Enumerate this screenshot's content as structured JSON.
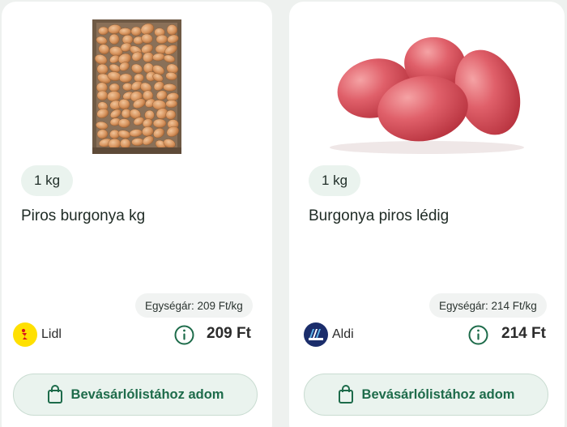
{
  "products": [
    {
      "image": "crate-of-red-potatoes",
      "quantity": "1 kg",
      "name": "Piros burgonya kg",
      "unit_price": "Egységár: 209 Ft/kg",
      "store": "Lidl",
      "store_icon": "lidl-logo-icon",
      "price": "209 Ft",
      "add_button": "Bevásárlólistához adom"
    },
    {
      "image": "red-potatoes",
      "quantity": "1 kg",
      "name": "Burgonya piros lédig",
      "unit_price": "Egységár: 214 Ft/kg",
      "store": "Aldi",
      "store_icon": "aldi-logo-icon",
      "price": "214 Ft",
      "add_button": "Bevásárlólistához adom"
    }
  ],
  "colors": {
    "accent": "#1d6b4a",
    "chip_bg": "#eaf3ee",
    "page_bg": "#eef1ef"
  }
}
